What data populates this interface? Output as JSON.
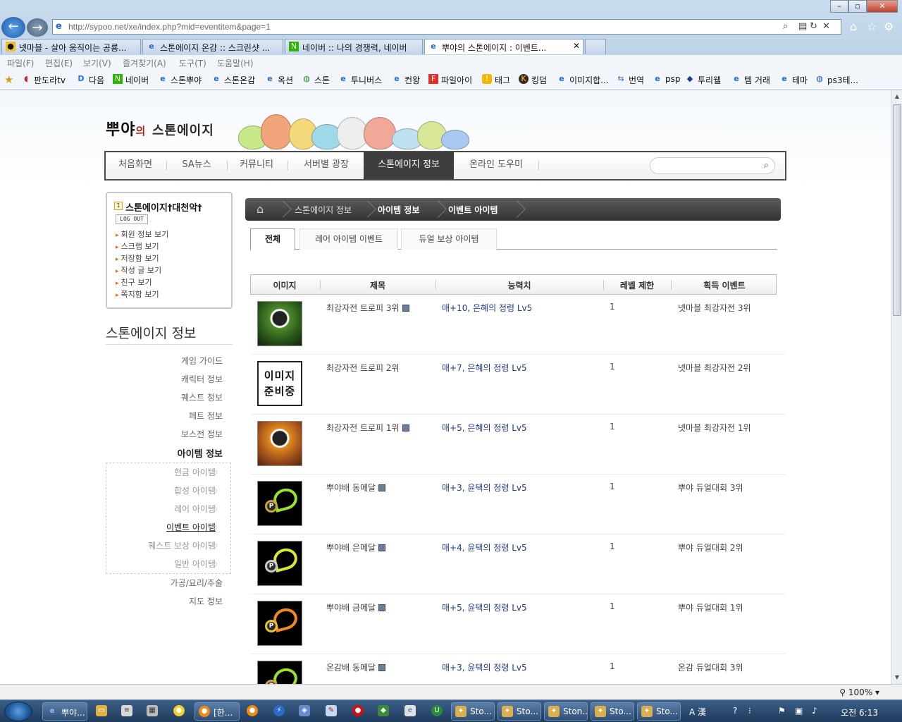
{
  "browser": {
    "address_url": "http://sypoo.net/xe/index.php?mid=eventitem&page=1",
    "tabs": [
      {
        "label": "넷마블 - 살아 움직이는 공룡..."
      },
      {
        "label": "스톤에이지 온감 :: 스크린샷 ..."
      },
      {
        "label": "네이버 :: 나의 경쟁력, 네이버"
      },
      {
        "label": "뿌야의 스톤에이지 : 이벤트..."
      }
    ],
    "menu": [
      "파일(F)",
      "편집(E)",
      "보기(V)",
      "즐겨찾기(A)",
      "도구(T)",
      "도움말(H)"
    ],
    "favorites": [
      "판도라tv",
      "다음",
      "네이버",
      "스톤뿌야",
      "스톤온감",
      "옥션",
      "스톤",
      "투니버스",
      "컨왕",
      "파일아이",
      "태그",
      "킹덤",
      "이미지합...",
      "번역",
      "psp",
      "투리웰",
      "템 거래",
      "테마",
      "ps3테..."
    ],
    "zoom": "100%"
  },
  "site": {
    "logo_main": "뿌야",
    "logo_small": "의",
    "logo_sub": "스톤에이지",
    "gnb": [
      "처음화면",
      "SA뉴스",
      "커뮤니티",
      "서버별 광장",
      "스톤에이지 정보",
      "온라인 도우미"
    ],
    "gnb_active_index": 4
  },
  "login": {
    "level_badge": "1",
    "nickname": "스톤에이지†대천악†",
    "logout_label": "LOG OUT",
    "links": [
      "회원 정보 보기",
      "스크랩 보기",
      "저장함 보기",
      "작성 글 보기",
      "친구 보기",
      "쪽지함 보기"
    ]
  },
  "sidebar": {
    "title": "스톤에이지 정보",
    "items": [
      "게임 가이드",
      "캐릭터 정보",
      "퀘스트 정보",
      "페트 정보",
      "보스전 정보",
      "아이템 정보"
    ],
    "sub_items": [
      "현금 아이템",
      "합성 아이템",
      "레어 아이템",
      "이벤트 아이템",
      "퀘스트 보상 아이템",
      "일반 아이템"
    ],
    "items_after": [
      "가공/요리/주술",
      "지도 정보"
    ]
  },
  "breadcrumb": [
    "스톤에이지 정보",
    "아이템 정보",
    "이벤트 아이템"
  ],
  "subtabs": [
    "전체",
    "레어 아이템 이벤트",
    "듀얼 보상 아이템"
  ],
  "table": {
    "headers": [
      "이미지",
      "제목",
      "능력치",
      "레벨 제한",
      "획득 이벤트"
    ],
    "rows": [
      {
        "image": "trophy-green",
        "title": "최강자전 트로피 3위",
        "stat": "매+10, 은혜의 정령 Lv5",
        "level": "1",
        "event": "넷마블 최강자전 3위"
      },
      {
        "image": "preparing",
        "title": "최강자전 트로피 2위",
        "stat": "매+7, 은혜의 정령 Lv5",
        "level": "1",
        "event": "넷마블 최강자전 2위"
      },
      {
        "image": "trophy-orange",
        "title": "최강자전 트로피 1위",
        "stat": "매+5, 은혜의 정령 Lv5",
        "level": "1",
        "event": "넷마블 최강자전 1위"
      },
      {
        "image": "medal",
        "title": "뿌야배 동메달",
        "stat": "매+3, 윤택의 정령 Lv5",
        "level": "1",
        "event": "뿌야 듀얼대회 3위"
      },
      {
        "image": "medal",
        "title": "뿌야배 은메달",
        "stat": "매+4, 윤택의 정령 Lv5",
        "level": "1",
        "event": "뿌야 듀얼대회 2위"
      },
      {
        "image": "medal",
        "title": "뿌야배 금메달",
        "stat": "매+5, 윤택의 정령 Lv5",
        "level": "1",
        "event": "뿌야 듀얼대회 1위"
      },
      {
        "image": "medal",
        "title": "온감배 동메달",
        "stat": "매+3, 윤택의 정령 Lv5",
        "level": "1",
        "event": "온감 듀얼대회 3위"
      }
    ],
    "preparing_line1": "이미지",
    "preparing_line2": "준비중"
  },
  "taskbar": {
    "buttons": [
      "뿌야...",
      "[한...",
      "Sto...",
      "Sto...",
      "Ston...",
      "Sto...",
      "Sto..."
    ],
    "clock": "오전 6:13"
  }
}
